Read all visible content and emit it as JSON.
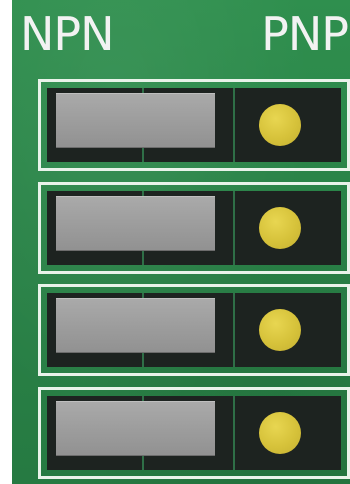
{
  "labels": {
    "left": "NPN",
    "right": "PNP"
  },
  "switches": [
    {
      "state": "NPN"
    },
    {
      "state": "NPN"
    },
    {
      "state": "NPN"
    },
    {
      "state": "NPN"
    }
  ]
}
